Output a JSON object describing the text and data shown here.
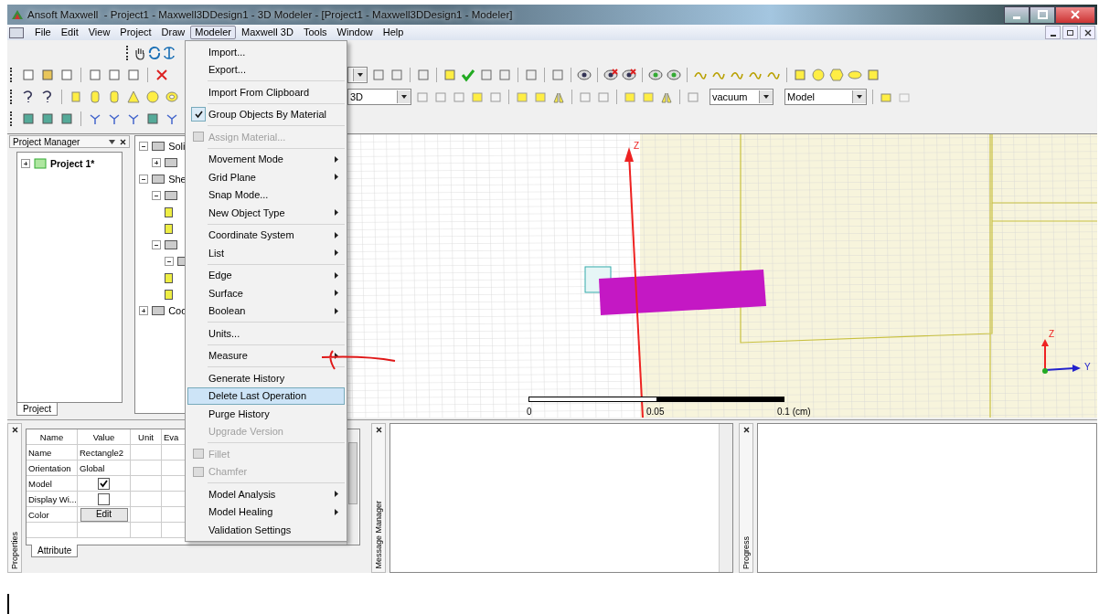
{
  "window": {
    "title": "Ansoft Maxwell  - Project1 - Maxwell3DDesign1 - 3D Modeler - [Project1 - Maxwell3DDesign1 - Modeler]"
  },
  "menu_bar": [
    {
      "label": "File",
      "selected": false
    },
    {
      "label": "Edit",
      "selected": false
    },
    {
      "label": "View",
      "selected": false
    },
    {
      "label": "Project",
      "selected": false
    },
    {
      "label": "Draw",
      "selected": false
    },
    {
      "label": "Modeler",
      "selected": true
    },
    {
      "label": "Maxwell 3D",
      "selected": false
    },
    {
      "label": "Tools",
      "selected": false
    },
    {
      "label": "Window",
      "selected": false
    },
    {
      "label": "Help",
      "selected": false
    }
  ],
  "toolbar": {
    "combos": [
      "3D",
      "vacuum",
      "Model"
    ]
  },
  "project_manager": {
    "title": "Project Manager",
    "tree": [
      {
        "label": "Project 1*",
        "expanded": false
      }
    ],
    "tab": "Project"
  },
  "model_tree": [
    {
      "kind": "folder",
      "label": "Soli",
      "expanded": true,
      "children": [
        {
          "kind": "folder",
          "expanded": false
        }
      ]
    },
    {
      "kind": "folder",
      "label": "She",
      "expanded": true,
      "children": [
        {
          "kind": "folder",
          "expanded": true,
          "children": [
            {
              "kind": "leaf"
            },
            {
              "kind": "leaf"
            }
          ]
        },
        {
          "kind": "folder",
          "expanded": true,
          "children": [
            {
              "kind": "folder",
              "expanded": true
            },
            {
              "kind": "leaf"
            },
            {
              "kind": "leaf"
            }
          ]
        }
      ]
    },
    {
      "kind": "folder",
      "label": "Coo",
      "expanded": false
    }
  ],
  "modeler_menu": {
    "groups": [
      [
        {
          "label": "Import...",
          "submenu": false,
          "disabled": false,
          "checked": false,
          "selected": false,
          "has_icon": false
        },
        {
          "label": "Export...",
          "submenu": false,
          "disabled": false,
          "checked": false,
          "selected": false,
          "has_icon": false
        }
      ],
      [
        {
          "label": "Import From Clipboard",
          "submenu": false,
          "disabled": false,
          "checked": false,
          "selected": false,
          "has_icon": false
        }
      ],
      [
        {
          "label": "Group Objects By Material",
          "submenu": false,
          "disabled": false,
          "checked": true,
          "selected": false,
          "has_icon": false
        }
      ],
      [
        {
          "label": "Assign Material...",
          "submenu": false,
          "disabled": true,
          "checked": false,
          "selected": false,
          "has_icon": true
        }
      ],
      [
        {
          "label": "Movement Mode",
          "submenu": true,
          "disabled": false,
          "checked": false,
          "selected": false,
          "has_icon": false
        },
        {
          "label": "Grid Plane",
          "submenu": true,
          "disabled": false,
          "checked": false,
          "selected": false,
          "has_icon": false
        },
        {
          "label": "Snap Mode...",
          "submenu": false,
          "disabled": false,
          "checked": false,
          "selected": false,
          "has_icon": false
        },
        {
          "label": "New Object Type",
          "submenu": true,
          "disabled": false,
          "checked": false,
          "selected": false,
          "has_icon": false
        }
      ],
      [
        {
          "label": "Coordinate System",
          "submenu": true,
          "disabled": false,
          "checked": false,
          "selected": false,
          "has_icon": false
        },
        {
          "label": "List",
          "submenu": true,
          "disabled": false,
          "checked": false,
          "selected": false,
          "has_icon": false
        }
      ],
      [
        {
          "label": "Edge",
          "submenu": true,
          "disabled": false,
          "checked": false,
          "selected": false,
          "has_icon": false
        },
        {
          "label": "Surface",
          "submenu": true,
          "disabled": false,
          "checked": false,
          "selected": false,
          "has_icon": false
        },
        {
          "label": "Boolean",
          "submenu": true,
          "disabled": false,
          "checked": false,
          "selected": false,
          "has_icon": false
        }
      ],
      [
        {
          "label": "Units...",
          "submenu": false,
          "disabled": false,
          "checked": false,
          "selected": false,
          "has_icon": false
        }
      ],
      [
        {
          "label": "Measure",
          "submenu": true,
          "disabled": false,
          "checked": false,
          "selected": false,
          "has_icon": false
        }
      ],
      [
        {
          "label": "Generate History",
          "submenu": false,
          "disabled": false,
          "checked": false,
          "selected": false,
          "has_icon": false
        },
        {
          "label": "Delete Last Operation",
          "submenu": false,
          "disabled": false,
          "checked": false,
          "selected": true,
          "has_icon": false
        },
        {
          "label": "Purge History",
          "submenu": false,
          "disabled": false,
          "checked": false,
          "selected": false,
          "has_icon": false
        },
        {
          "label": "Upgrade Version",
          "submenu": false,
          "disabled": true,
          "checked": false,
          "selected": false,
          "has_icon": false
        }
      ],
      [
        {
          "label": "Fillet",
          "submenu": false,
          "disabled": true,
          "checked": false,
          "selected": false,
          "has_icon": true
        },
        {
          "label": "Chamfer",
          "submenu": false,
          "disabled": true,
          "checked": false,
          "selected": false,
          "has_icon": true
        }
      ],
      [
        {
          "label": "Model Analysis",
          "submenu": true,
          "disabled": false,
          "checked": false,
          "selected": false,
          "has_icon": false
        },
        {
          "label": "Model Healing",
          "submenu": true,
          "disabled": false,
          "checked": false,
          "selected": false,
          "has_icon": false
        },
        {
          "label": "Validation Settings",
          "submenu": false,
          "disabled": false,
          "checked": false,
          "selected": false,
          "has_icon": false
        }
      ]
    ]
  },
  "viewport": {
    "axis_label": "Z",
    "scale_labels": [
      "0",
      "0.05",
      "0.1 (cm)"
    ],
    "triad_labels": [
      "Z",
      "Y"
    ]
  },
  "properties": {
    "side_label": "Properties",
    "columns": [
      "Name",
      "Value",
      "Unit",
      "Eva"
    ],
    "rows": [
      {
        "name": "Name",
        "kind": "text",
        "value": "Rectangle2"
      },
      {
        "name": "Orientation",
        "kind": "text",
        "value": "Global"
      },
      {
        "name": "Model",
        "kind": "checkbox",
        "checked": true
      },
      {
        "name": "Display Wi...",
        "kind": "checkbox",
        "checked": false
      },
      {
        "name": "Color",
        "kind": "button",
        "value": "Edit"
      }
    ],
    "tab": "Attribute"
  },
  "message_manager": {
    "side_label": "Message Manager"
  },
  "progress": {
    "side_label": "Progress"
  }
}
